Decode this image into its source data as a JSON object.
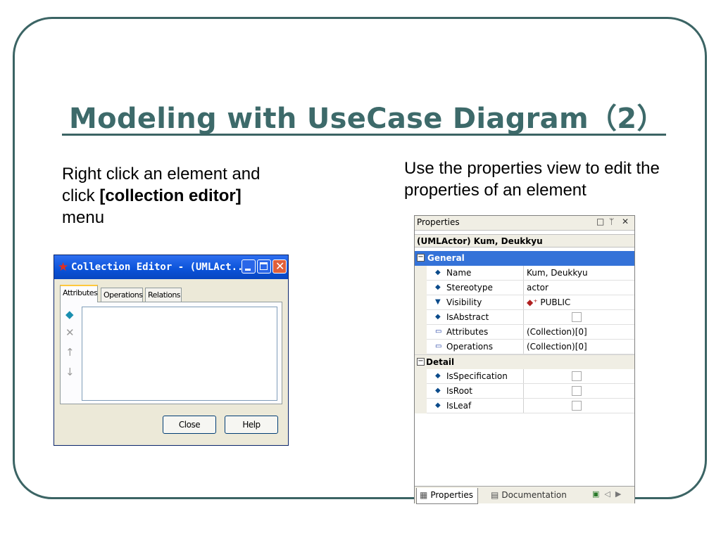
{
  "slide": {
    "title": "Modeling with UseCase Diagram（2）",
    "left_text_plain1": "Right click an element and click ",
    "left_text_bold": "[collection editor]",
    "left_text_plain2": " menu",
    "right_text": "Use the properties view to edit the properties of an element"
  },
  "collection_editor": {
    "title": "Collection Editor - (UMLAct...",
    "tabs": [
      "Attributes",
      "Operations",
      "Relations"
    ],
    "active_tab": "Attributes",
    "close_label": "Close",
    "help_label": "Help"
  },
  "properties": {
    "header": "Properties",
    "object": "(UMLActor) Kum, Deukkyu",
    "general_label": "General",
    "detail_label": "Detail",
    "rows": [
      {
        "name": "Name",
        "value": "Kum, Deukkyu"
      },
      {
        "name": "Stereotype",
        "value": "actor"
      },
      {
        "name": "Visibility",
        "value": "PUBLIC"
      },
      {
        "name": "IsAbstract",
        "value": ""
      },
      {
        "name": "Attributes",
        "value": "(Collection)[0]"
      },
      {
        "name": "Operations",
        "value": "(Collection)[0]"
      }
    ],
    "detail_rows": [
      {
        "name": "IsSpecification"
      },
      {
        "name": "IsRoot"
      },
      {
        "name": "IsLeaf"
      }
    ],
    "bottom_tabs": [
      "Properties",
      "Documentation"
    ]
  },
  "colors": {
    "title": "#3d6a6a",
    "frame": "#3b6464",
    "selection": "#3472d8"
  }
}
